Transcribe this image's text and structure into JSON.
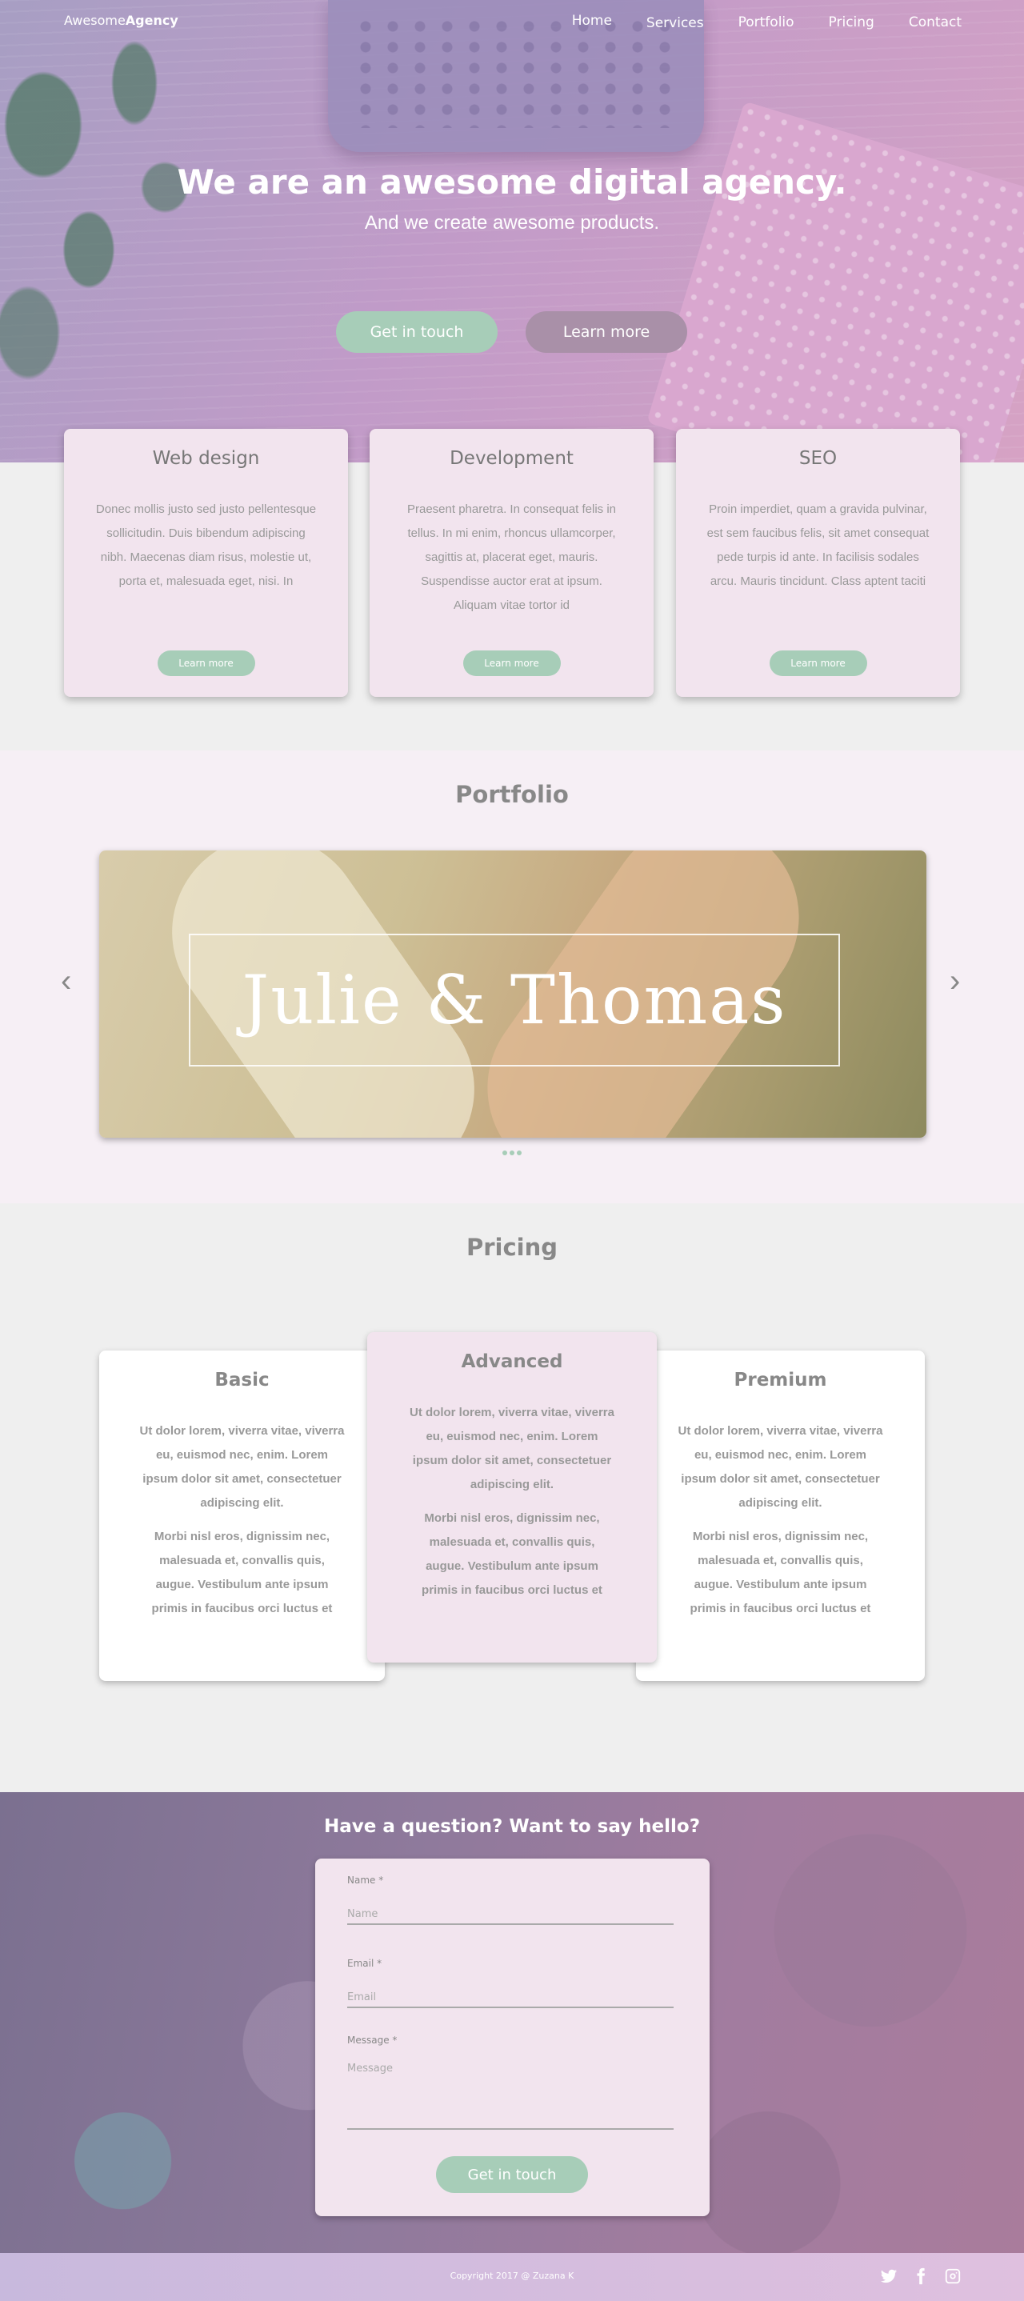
{
  "nav": {
    "logo_light": "Awesome",
    "logo_bold": "Agency",
    "items": [
      {
        "label": "Home"
      },
      {
        "label": "Services"
      },
      {
        "label": "Portfolio"
      },
      {
        "label": "Pricing"
      },
      {
        "label": "Contact"
      }
    ]
  },
  "hero": {
    "title": "We are an awesome digital agency.",
    "subtitle": "And we create awesome products.",
    "primary_button": "Get in touch",
    "secondary_button": "Learn more"
  },
  "services": [
    {
      "title": "Web design",
      "text": "Donec mollis justo sed justo pellentesque sollicitudin. Duis bibendum adipiscing nibh. Maecenas diam risus, molestie ut, porta et, malesuada eget, nisi. In",
      "button": "Learn more"
    },
    {
      "title": "Development",
      "text": "Praesent pharetra. In consequat felis in tellus. In mi enim, rhoncus ullamcorper, sagittis at, placerat eget, mauris. Suspendisse auctor erat at ipsum. Aliquam vitae tortor id",
      "button": "Learn more"
    },
    {
      "title": "SEO",
      "text": "Proin imperdiet, quam a gravida pulvinar, est sem faucibus felis, sit amet consequat pede turpis id ante. In facilisis sodales arcu. Mauris tincidunt. Class aptent taciti",
      "button": "Learn more"
    }
  ],
  "portfolio": {
    "title": "Portfolio",
    "slide_text": "Julie & Thomas",
    "prev_glyph": "‹",
    "next_glyph": "›"
  },
  "pricing": {
    "title": "Pricing",
    "plans": [
      {
        "name": "Basic",
        "p1": "Ut dolor lorem, viverra vitae, viverra eu, euismod nec, enim. Lorem ipsum dolor sit amet, consectetuer adipiscing elit.",
        "p2": "Morbi nisl eros, dignissim nec, malesuada et, convallis quis, augue. Vestibulum ante ipsum primis in faucibus orci luctus et"
      },
      {
        "name": "Advanced",
        "p1": "Ut dolor lorem, viverra vitae, viverra eu, euismod nec, enim. Lorem ipsum dolor sit amet, consectetuer adipiscing elit.",
        "p2": "Morbi nisl eros, dignissim nec, malesuada et, convallis quis, augue. Vestibulum ante ipsum primis in faucibus orci luctus et"
      },
      {
        "name": "Premium",
        "p1": "Ut dolor lorem, viverra vitae, viverra eu, euismod nec, enim. Lorem ipsum dolor sit amet, consectetuer adipiscing elit.",
        "p2": "Morbi nisl eros, dignissim nec, malesuada et, convallis quis, augue. Vestibulum ante ipsum primis in faucibus orci luctus et"
      }
    ]
  },
  "contact": {
    "title_1": "Have a ",
    "title_2": "question",
    "title_3": "? Want to say ",
    "title_4": "hello",
    "title_5": "?",
    "name_label": "Name *",
    "name_placeholder": "Name",
    "email_label": "Email *",
    "email_placeholder": "Email",
    "message_label": "Message *",
    "message_placeholder": "Message",
    "submit": "Get in touch"
  },
  "footer": {
    "copyright": "Copyright 2017 @ Zuzana K",
    "social": [
      "twitter-icon",
      "facebook-icon",
      "instagram-icon"
    ]
  },
  "colors": {
    "accent_green": "#a7cdb8",
    "card_pink": "#f2e4ee"
  }
}
